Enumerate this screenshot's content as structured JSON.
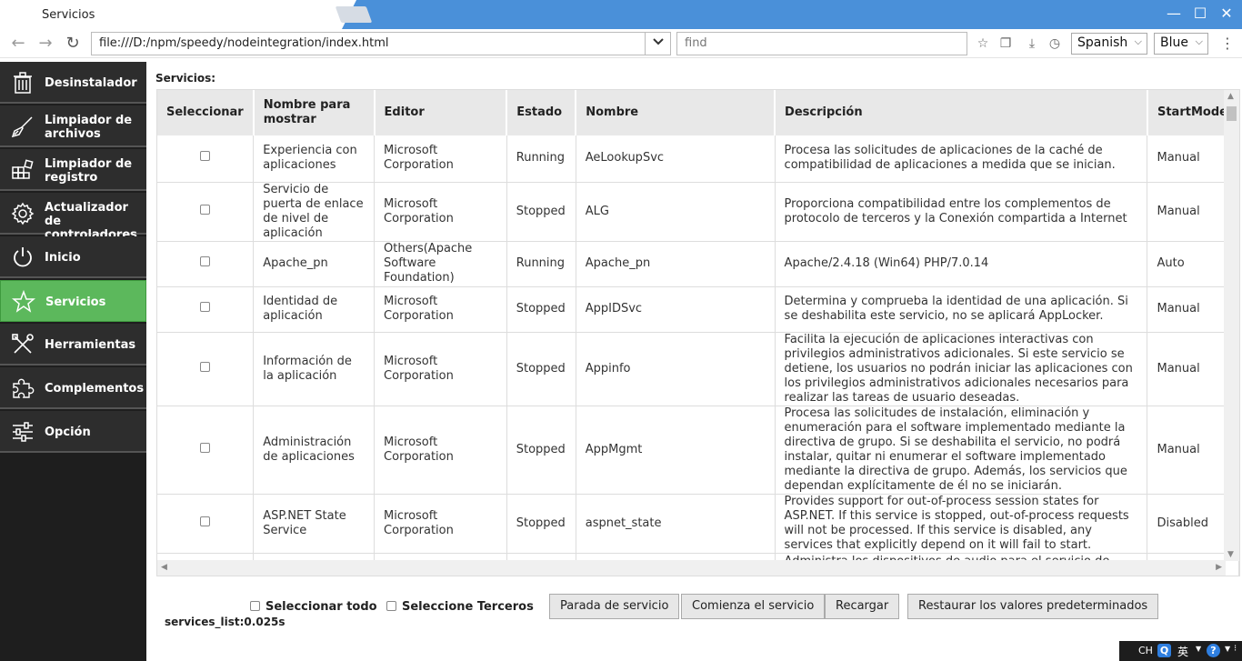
{
  "window": {
    "tab_title": "Servicios",
    "minimize": "—",
    "maximize": "☐",
    "close": "✕"
  },
  "toolbar": {
    "url": "file:///D:/npm/speedy/nodeintegration/index.html",
    "find_placeholder": "find",
    "language": "Spanish",
    "theme": "Blue"
  },
  "sidebar": {
    "items": [
      {
        "label": "Desinstalador",
        "icon": "trash-icon"
      },
      {
        "label": "Limpiador de archivos",
        "icon": "broom-icon"
      },
      {
        "label": "Limpiador de registro",
        "icon": "registry-icon"
      },
      {
        "label": "Actualizador de controladores",
        "icon": "gear-icon"
      },
      {
        "label": "Inicio",
        "icon": "power-icon"
      },
      {
        "label": "Servicios",
        "icon": "star-icon",
        "active": true
      },
      {
        "label": "Herramientas",
        "icon": "tools-icon"
      },
      {
        "label": "Complementos",
        "icon": "puzzle-icon"
      },
      {
        "label": "Opción",
        "icon": "sliders-icon"
      }
    ]
  },
  "main": {
    "title": "Servicios:",
    "columns": [
      "Seleccionar",
      "Nombre para mostrar",
      "Editor",
      "Estado",
      "Nombre",
      "Descripción",
      "StartMode"
    ],
    "rows": [
      {
        "display": "Experiencia con aplicaciones",
        "editor": "Microsoft Corporation",
        "state": "Running",
        "name": "AeLookupSvc",
        "desc": "Procesa las solicitudes de aplicaciones de la caché de compatibilidad de aplicaciones a medida que se inician.",
        "mode": "Manual"
      },
      {
        "display": "Servicio de puerta de enlace de nivel de aplicación",
        "editor": "Microsoft Corporation",
        "state": "Stopped",
        "name": "ALG",
        "desc": "Proporciona compatibilidad entre los complementos de protocolo de terceros y la Conexión compartida a Internet",
        "mode": "Manual"
      },
      {
        "display": "Apache_pn",
        "editor": "Others(Apache Software Foundation)",
        "state": "Running",
        "name": "Apache_pn",
        "desc": "Apache/2.4.18 (Win64) PHP/7.0.14",
        "mode": "Auto"
      },
      {
        "display": "Identidad de aplicación",
        "editor": "Microsoft Corporation",
        "state": "Stopped",
        "name": "AppIDSvc",
        "desc": "Determina y comprueba la identidad de una aplicación. Si se deshabilita este servicio, no se aplicará AppLocker.",
        "mode": "Manual"
      },
      {
        "display": "Información de la aplicación",
        "editor": "Microsoft Corporation",
        "state": "Stopped",
        "name": "Appinfo",
        "desc": "Facilita la ejecución de aplicaciones interactivas con privilegios administrativos adicionales. Si este servicio se detiene, los usuarios no podrán iniciar las aplicaciones con los privilegios administrativos adicionales necesarios para realizar las tareas de usuario deseadas.",
        "mode": "Manual"
      },
      {
        "display": "Administración de aplicaciones",
        "editor": "Microsoft Corporation",
        "state": "Stopped",
        "name": "AppMgmt",
        "desc": "Procesa las solicitudes de instalación, eliminación y enumeración para el software implementado mediante la directiva de grupo. Si se deshabilita el servicio, no podrá instalar, quitar ni enumerar el software implementado mediante la directiva de grupo. Además, los servicios que dependan explícitamente de él no se iniciarán.",
        "mode": "Manual"
      },
      {
        "display": "ASP.NET State Service",
        "editor": "Microsoft Corporation",
        "state": "Stopped",
        "name": "aspnet_state",
        "desc": "Provides support for out-of-process session states for ASP.NET. If this service is stopped, out-of-process requests will not be processed. If this service is disabled, any services that explicitly depend on it will fail to start.",
        "mode": "Disabled"
      },
      {
        "display": "",
        "editor": "",
        "state": "",
        "name": "",
        "desc": "Administra los dispositivos de audio para el servicio de Audio",
        "mode": ""
      }
    ]
  },
  "bottom": {
    "select_all": "Seleccionar todo",
    "select_third": "Seleccione Terceros",
    "stop_btn": "Parada de servicio",
    "start_btn": "Comienza el servicio",
    "reload_btn": "Recargar",
    "restore_btn": "Restaurar los valores predeterminados",
    "timing": "services_list:0.025s"
  },
  "taskbar": {
    "ime_lang": "CH",
    "ime_mode": "英"
  }
}
